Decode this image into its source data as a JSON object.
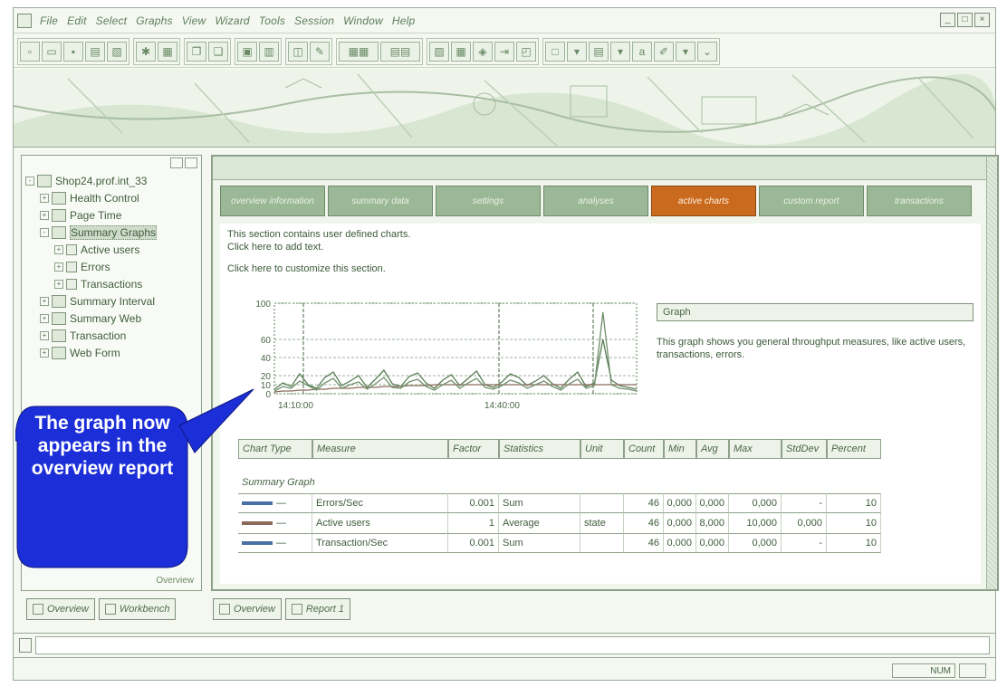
{
  "menubar": {
    "items": [
      "File",
      "Edit",
      "Select",
      "Graphs",
      "View",
      "Wizard",
      "Tools",
      "Session",
      "Window",
      "Help"
    ],
    "window_controls": [
      "_",
      "□",
      "×"
    ]
  },
  "toolbar": {
    "icons": [
      "new-icon",
      "open-icon",
      "save-icon",
      "print-icon",
      "export-icon",
      "settings-icon",
      "copy-icon",
      "paste-icon",
      "zoom-in-icon",
      "zoom-out-icon",
      "filter-icon",
      "edit-icon",
      "add-graph-icon",
      "merge-graph-icon",
      "layout-icon",
      "grid-icon",
      "legend-icon",
      "arrow-icon",
      "color-icon",
      "font-icon",
      "pointer-icon"
    ]
  },
  "tree": {
    "items": [
      {
        "label": "Shop24.prof.int_33",
        "indent": 0,
        "exp": "-"
      },
      {
        "label": "Health Control",
        "indent": 1,
        "exp": "+"
      },
      {
        "label": "Page Time",
        "indent": 1,
        "exp": "+"
      },
      {
        "label": "Summary Graphs",
        "indent": 1,
        "exp": "-",
        "selected": true
      },
      {
        "label": "Active users",
        "indent": 2,
        "exp": "+",
        "small": true
      },
      {
        "label": "Errors",
        "indent": 2,
        "exp": "+",
        "small": true
      },
      {
        "label": "Transactions",
        "indent": 2,
        "exp": "+",
        "small": true
      },
      {
        "label": "Summary Interval",
        "indent": 1,
        "exp": "+"
      },
      {
        "label": "Summary Web",
        "indent": 1,
        "exp": "+"
      },
      {
        "label": "Transaction",
        "indent": 1,
        "exp": "+"
      },
      {
        "label": "Web Form",
        "indent": 1,
        "exp": "+"
      }
    ],
    "footer": "Overview"
  },
  "left_tabs": [
    "Overview",
    "Workbench"
  ],
  "tabs": [
    {
      "label": "overview information",
      "active": false
    },
    {
      "label": "summary data",
      "active": false
    },
    {
      "label": "settings",
      "active": false
    },
    {
      "label": "analyses",
      "active": false
    },
    {
      "label": "active charts",
      "active": true
    },
    {
      "label": "custom report",
      "active": false
    },
    {
      "label": "transactions",
      "active": false
    }
  ],
  "content": {
    "line1": "This section contains user defined charts.",
    "line2": "Click here to add text.",
    "line3": "Click here to customize this section.",
    "graph_title": "Graph",
    "graph_desc": "This graph shows you general throughput measures, like active users, transactions, errors.",
    "section_title": "Summary Graph"
  },
  "chart_data": {
    "type": "line",
    "yticks": [
      0,
      10,
      20,
      40,
      60,
      100
    ],
    "ylim": [
      0,
      100
    ],
    "xticks": [
      "14:10:00",
      "14:40:00"
    ],
    "series": [
      {
        "name": "Errors/Sec",
        "color": "#5a7d56",
        "values": [
          5,
          12,
          8,
          22,
          10,
          6,
          18,
          24,
          9,
          14,
          20,
          7,
          16,
          26,
          11,
          8,
          19,
          23,
          12,
          6,
          15,
          21,
          9,
          17,
          25,
          10,
          7,
          13,
          22,
          18,
          9,
          14,
          20,
          11,
          6,
          16,
          24,
          8,
          12,
          60,
          15,
          9,
          7,
          5
        ]
      },
      {
        "name": "Active users",
        "color": "#8a6a5a",
        "values": [
          2,
          3,
          3,
          4,
          4,
          5,
          5,
          6,
          6,
          6,
          7,
          7,
          7,
          8,
          8,
          8,
          9,
          9,
          9,
          10,
          10,
          10,
          10,
          10,
          10,
          10,
          10,
          10,
          10,
          10,
          10,
          10,
          10,
          10,
          10,
          10,
          10,
          10,
          10,
          10,
          10,
          10,
          10,
          10
        ]
      },
      {
        "name": "Transaction/Sec",
        "color": "#6f8f6b",
        "values": [
          3,
          8,
          6,
          14,
          9,
          4,
          12,
          17,
          6,
          10,
          13,
          5,
          11,
          18,
          7,
          6,
          13,
          16,
          8,
          4,
          10,
          15,
          6,
          12,
          17,
          7,
          5,
          9,
          15,
          12,
          6,
          10,
          14,
          8,
          4,
          11,
          16,
          6,
          9,
          90,
          10,
          6,
          5,
          3
        ]
      }
    ],
    "markers": [
      0.08,
      0.62,
      0.88
    ]
  },
  "table": {
    "headers": [
      "Chart Type",
      "Measure",
      "Factor",
      "Statistics",
      "Unit",
      "Count",
      "Min",
      "Avg",
      "Max",
      "StdDev",
      "Percent"
    ],
    "rows": [
      {
        "color": "#4a6fa5",
        "sym": "—",
        "measure": "Errors/Sec",
        "factor": "0.001",
        "stat": "Sum",
        "unit": "",
        "count": "46",
        "min": "0,000",
        "avg": "0,000",
        "max": "0,000",
        "std": "-",
        "pct": "10"
      },
      {
        "color": "#8a6a5a",
        "sym": "—",
        "measure": "Active users",
        "factor": "1",
        "stat": "Average",
        "unit": "state",
        "count": "46",
        "min": "0,000",
        "avg": "8,000",
        "max": "10,000",
        "std": "0,000",
        "pct": "10"
      },
      {
        "color": "#4a6fa5",
        "sym": "—",
        "measure": "Transaction/Sec",
        "factor": "0.001",
        "stat": "Sum",
        "unit": "",
        "count": "46",
        "min": "0,000",
        "avg": "0,000",
        "max": "0,000",
        "std": "-",
        "pct": "10"
      }
    ]
  },
  "main_tabs": [
    "Overview",
    "Report 1"
  ],
  "statusbar": {
    "cell1": "NUM",
    "cell2": ""
  },
  "callout": {
    "text": "The graph now appears in the overview report",
    "color": "#1c2ed8"
  }
}
